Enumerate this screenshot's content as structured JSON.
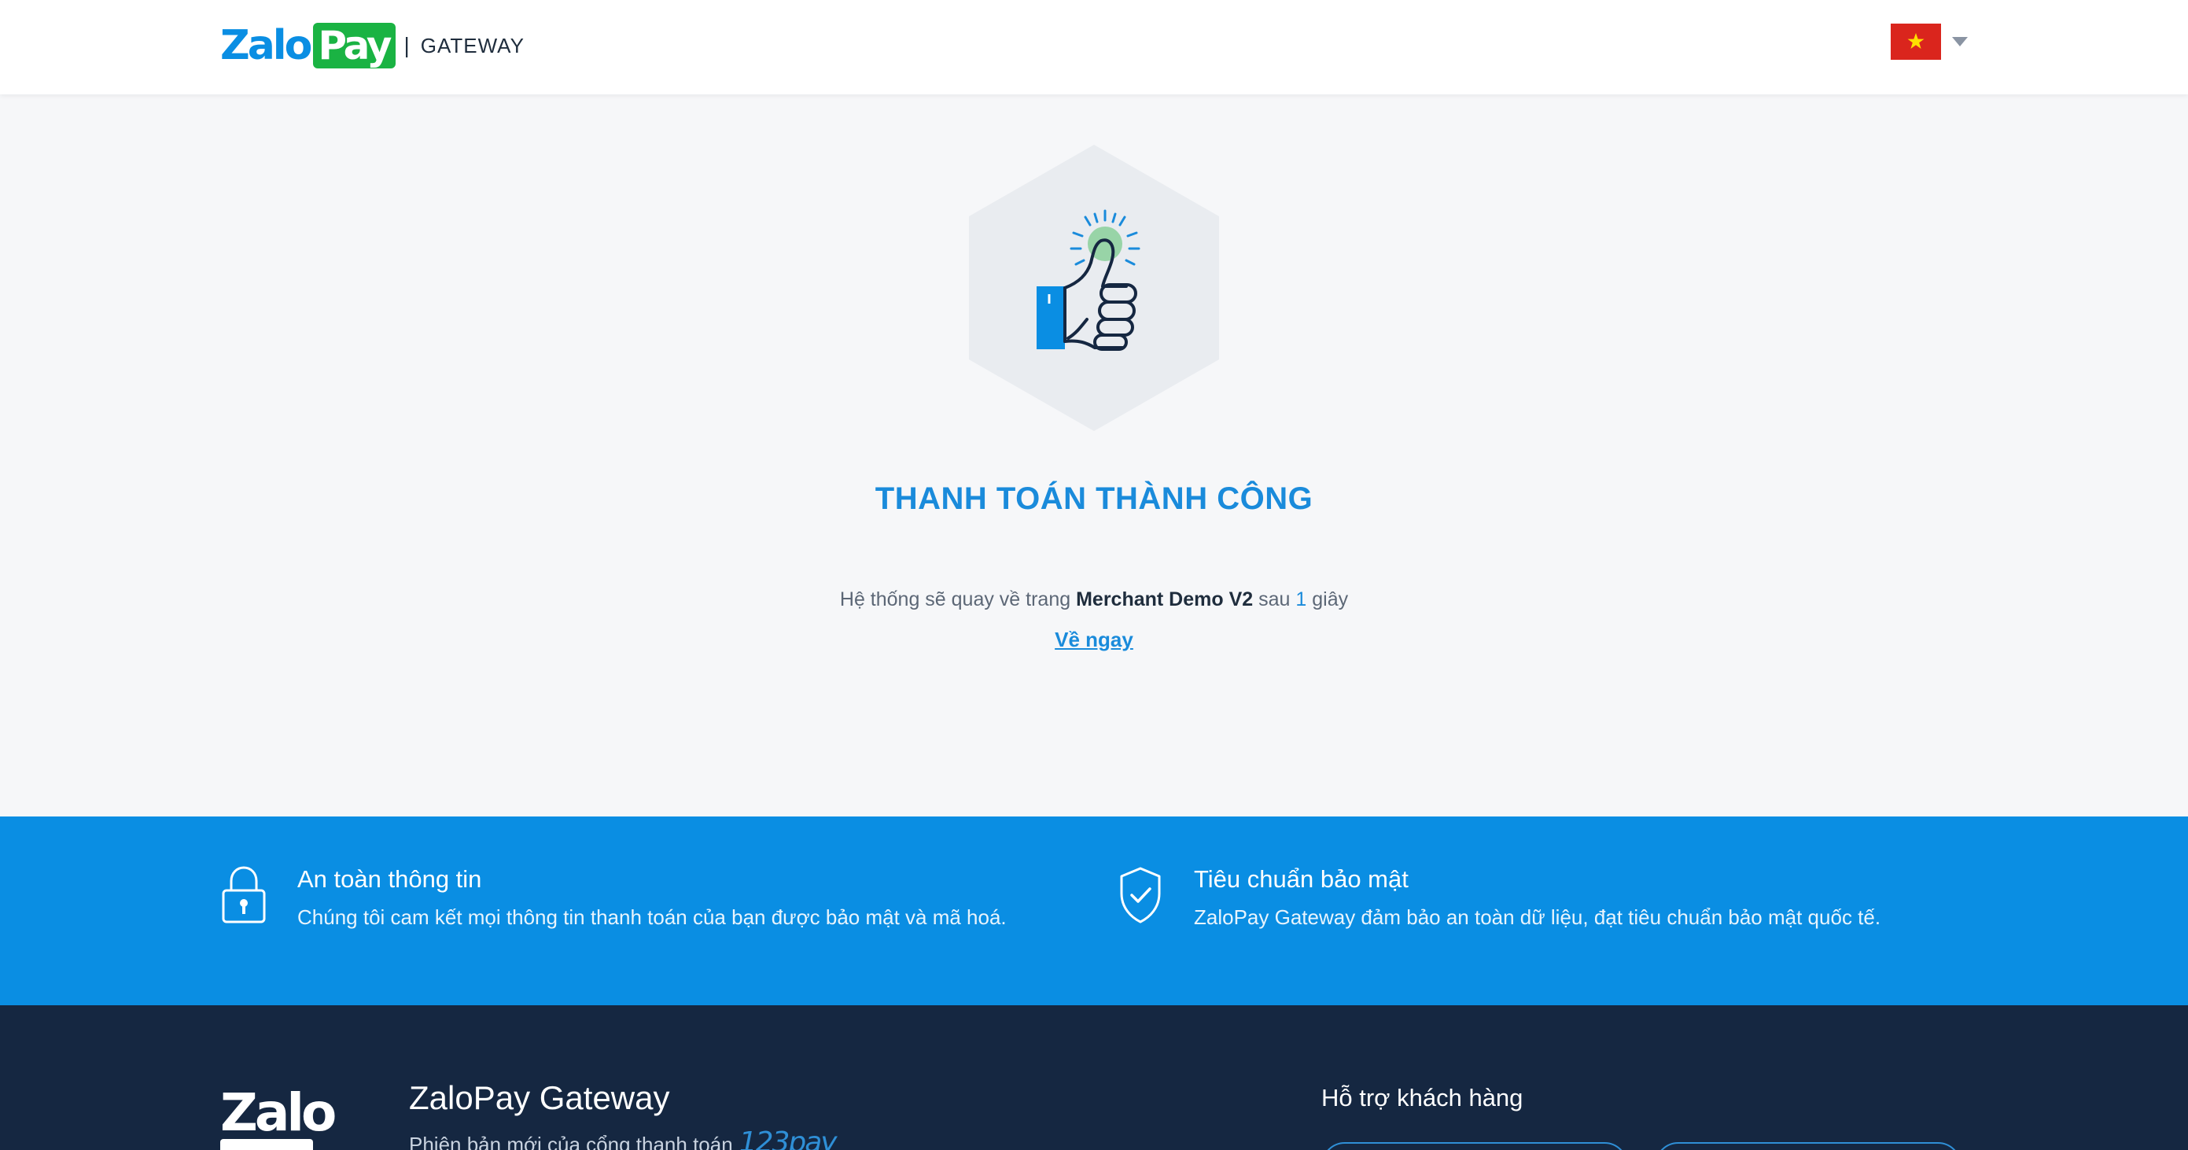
{
  "header": {
    "logo_zalo": "Zalo",
    "logo_pay": "Pay",
    "logo_separator": "|",
    "logo_suffix": "GATEWAY",
    "language_flag": "vietnam-flag-icon"
  },
  "result": {
    "illustration": "thumbs-up-icon",
    "title": "THANH TOÁN THÀNH CÔNG",
    "redirect_prefix": "Hệ thống sẽ quay về trang",
    "merchant_name": "Merchant Demo V2",
    "redirect_middle": "sau",
    "countdown": "1",
    "redirect_suffix": "giây",
    "back_now_label": "Về ngay"
  },
  "features": [
    {
      "icon": "lock-icon",
      "title": "An toàn thông tin",
      "description": "Chúng tôi cam kết mọi thông tin thanh toán của bạn được bảo mật và mã hoá."
    },
    {
      "icon": "shield-check-icon",
      "title": "Tiêu chuẩn bảo mật",
      "description": "ZaloPay Gateway đảm bảo an toàn dữ liệu, đạt tiêu chuẩn bảo mật quốc tế."
    }
  ],
  "footer": {
    "logo_text": "Zalo",
    "brand_title": "ZaloPay Gateway",
    "brand_subtitle": "Phiên bản mới của cổng thanh toán",
    "partner_logo": "123pay",
    "support_title": "Hỗ trợ khách hàng"
  },
  "colors": {
    "brand_blue": "#0a8ee3",
    "title_blue": "#1a8bdb",
    "brand_green": "#1ab343",
    "footer_navy": "#152741",
    "flag_red": "#da251d",
    "flag_star": "#ffdf00"
  }
}
